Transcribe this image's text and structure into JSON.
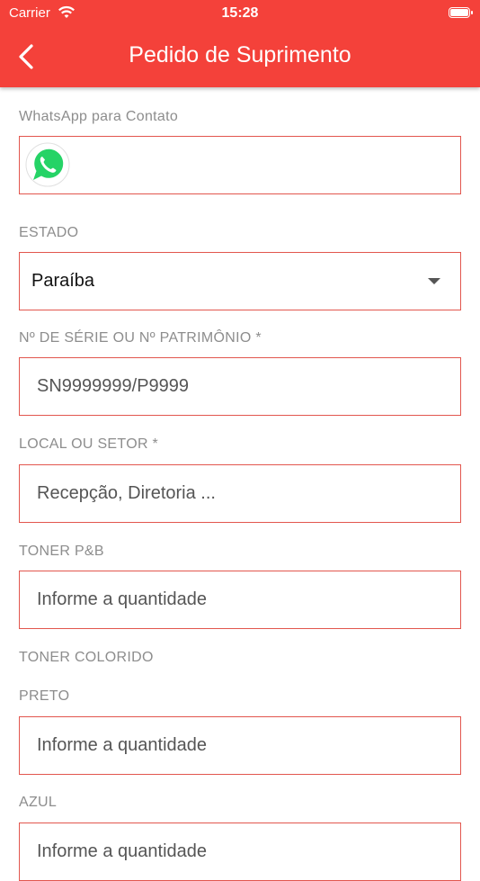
{
  "status_bar": {
    "carrier": "Carrier",
    "time": "15:28"
  },
  "header": {
    "title": "Pedido de Suprimento"
  },
  "form": {
    "whatsapp": {
      "label": "WhatsApp para Contato",
      "value": ""
    },
    "estado": {
      "label": "ESTADO",
      "value": "Paraíba"
    },
    "serie": {
      "label": "Nº DE SÉRIE OU Nº PATRIMÔNIO *",
      "placeholder": "SN9999999/P9999"
    },
    "local": {
      "label": "LOCAL OU SETOR *",
      "placeholder": "Recepção, Diretoria ..."
    },
    "toner_pb": {
      "label": "TONER P&B",
      "placeholder": "Informe a quantidade"
    },
    "toner_colorido": {
      "label": "TONER COLORIDO"
    },
    "preto": {
      "label": "PRETO",
      "placeholder": "Informe a quantidade"
    },
    "azul": {
      "label": "AZUL",
      "placeholder": "Informe a quantidade"
    }
  },
  "colors": {
    "header": "#f4413a",
    "field_border": "#e2564e",
    "whatsapp": "#25d366"
  }
}
